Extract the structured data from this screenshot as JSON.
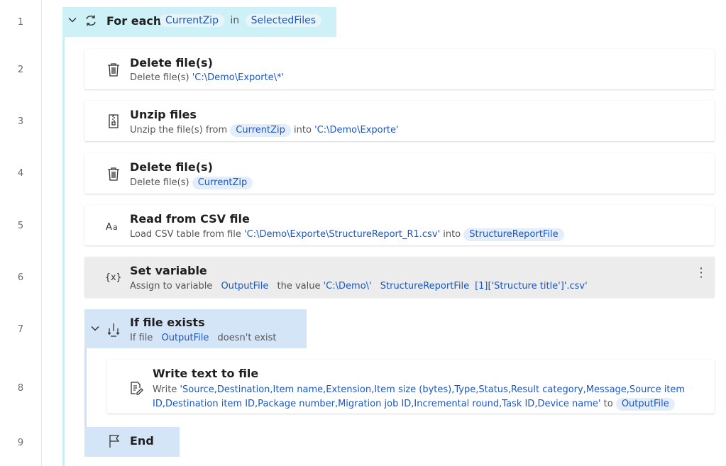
{
  "line_numbers": [
    "1",
    "2",
    "3",
    "4",
    "5",
    "6",
    "7",
    "8",
    "9"
  ],
  "loop": {
    "title": "For each",
    "item_var": "CurrentZip",
    "in_label": "in",
    "list_var": "SelectedFiles"
  },
  "actions": {
    "delete1": {
      "title": "Delete file(s)",
      "desc_prefix": "Delete file(s) ",
      "path": "'C:\\Demo\\Exporte\\*'"
    },
    "unzip": {
      "title": "Unzip files",
      "desc_prefix": "Unzip the file(s) from ",
      "var": "CurrentZip",
      "into_label": " into ",
      "path": "'C:\\Demo\\Exporte'"
    },
    "delete2": {
      "title": "Delete file(s)",
      "desc_prefix": "Delete file(s) ",
      "var": "CurrentZip"
    },
    "readcsv": {
      "title": "Read from CSV file",
      "desc_prefix": "Load CSV table from file ",
      "path": "'C:\\Demo\\Exporte\\StructureReport_R1.csv'",
      "into_label": " into ",
      "var": "StructureReportFile"
    },
    "setvar": {
      "title": "Set variable",
      "desc_prefix": "Assign to variable ",
      "var": "OutputFile",
      "value_label": " the value ",
      "str1": "'C:\\Demo\\'",
      "var2": "StructureReportFile",
      "str2": "[1]['Structure title']'.csv'",
      "more_label": "⋮"
    },
    "iffile": {
      "title": "If file exists",
      "desc_prefix": "If file ",
      "var": "OutputFile",
      "suffix": " doesn't exist"
    },
    "writetext": {
      "title": "Write text to file",
      "desc_prefix": "Write ",
      "str": "'Source,Destination,Item name,Extension,Item size (bytes),Type,Status,Result category,Message,Source item ID,Destination item ID,Package number,Migration job ID,Incremental round,Task ID,Device name'",
      "to_label": " to ",
      "var": "OutputFile"
    },
    "end": {
      "title": "End"
    }
  },
  "icons": {
    "loop": "loop-icon",
    "trash": "trash-icon",
    "zip": "zip-icon",
    "csv": "text-format-icon",
    "variable": "variable-icon",
    "branch": "branch-icon",
    "write": "write-file-icon",
    "flag": "flag-icon",
    "chevron": "chevron-down-icon"
  },
  "colors": {
    "loop_bg": "#cdf1f6",
    "if_bg": "#d5e5f8",
    "variable_pill": "#e4eefb",
    "string_text": "#1a56c4",
    "selected_card": "#ececec"
  }
}
